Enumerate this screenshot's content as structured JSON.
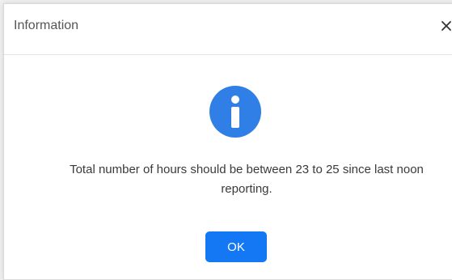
{
  "dialog": {
    "title": "Information",
    "close_icon": "close-icon",
    "icon": "info-icon",
    "message_line1": "Total number of hours should be between 23 to 25 since last noon",
    "message_line2": "reporting.",
    "ok_label": "OK"
  },
  "colors": {
    "accent": "#1478f5",
    "icon": "#2f7fe6"
  }
}
